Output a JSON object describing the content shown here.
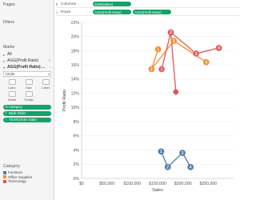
{
  "pages": {
    "title": "Pages"
  },
  "filters": {
    "title": "Filters"
  },
  "marks": {
    "title": "Marks",
    "rows": [
      {
        "label": "All",
        "bold": false
      },
      {
        "label": "AGG(Profit Ratio)",
        "bold": false
      },
      {
        "label": "AGG(Profit Ratio) ...",
        "bold": true
      }
    ],
    "mark_type": "Circle",
    "buttons": [
      "Color",
      "Size",
      "Label",
      "Detail",
      "Tooltip"
    ],
    "pills": [
      "Category",
      "Mark Order",
      "YEAR(Order Date)"
    ]
  },
  "legend": {
    "title": "Category",
    "items": [
      {
        "label": "Furniture",
        "color": "#4e79a7"
      },
      {
        "label": "Office Supplies",
        "color": "#f28e2b"
      },
      {
        "label": "Technology",
        "color": "#e15759"
      }
    ]
  },
  "shelves": {
    "columns_label": "Columns",
    "rows_label": "Rows",
    "columns_pills": [
      "SUM(Sales)"
    ],
    "rows_pills": [
      "AGG(Profit Ratio)",
      "AGG(Profit Ratio)"
    ]
  },
  "chart_data": {
    "type": "line",
    "xlabel": "Sales",
    "ylabel": "Profit Ratio",
    "xlim": [
      0,
      300000
    ],
    "ylim": [
      0,
      22
    ],
    "x_ticks": [
      0,
      50000,
      100000,
      150000,
      200000,
      250000
    ],
    "x_tick_labels": [
      "$0",
      "$50,000",
      "$100,000",
      "$150,000",
      "$200,000",
      "$250,000"
    ],
    "y_ticks": [
      0,
      2,
      4,
      6,
      8,
      10,
      12,
      14,
      16,
      18,
      20,
      22
    ],
    "y_tick_labels": [
      "0%",
      "2%",
      "4%",
      "6%",
      "8%",
      "10%",
      "12%",
      "14%",
      "16%",
      "18%",
      "20%",
      "22%"
    ],
    "series": [
      {
        "name": "Furniture",
        "color": "#4e79a7",
        "points": [
          {
            "x": 157000,
            "y": 3.8,
            "label": "1"
          },
          {
            "x": 170000,
            "y": 1.6,
            "label": "2"
          },
          {
            "x": 199000,
            "y": 3.6,
            "label": "3"
          },
          {
            "x": 215000,
            "y": 1.6,
            "label": "4"
          }
        ]
      },
      {
        "name": "Office Supplies",
        "color": "#f28e2b",
        "points": [
          {
            "x": 151000,
            "y": 18.2,
            "label": "1"
          },
          {
            "x": 138000,
            "y": 15.4,
            "label": "2"
          },
          {
            "x": 182000,
            "y": 19.4,
            "label": "3"
          },
          {
            "x": 246000,
            "y": 16.4,
            "label": "4"
          }
        ]
      },
      {
        "name": "Technology",
        "color": "#e15759",
        "points": [
          {
            "x": 176000,
            "y": 20.6,
            "label": "2"
          },
          {
            "x": 158000,
            "y": 15.4,
            "label": "1"
          },
          {
            "x": 226000,
            "y": 17.6,
            "label": "3"
          },
          {
            "x": 271000,
            "y": 18.4,
            "label": "4"
          },
          {
            "x": 186000,
            "y": 12.2,
            "label": ""
          }
        ],
        "path_order": [
          1,
          0,
          2,
          3
        ]
      }
    ]
  }
}
